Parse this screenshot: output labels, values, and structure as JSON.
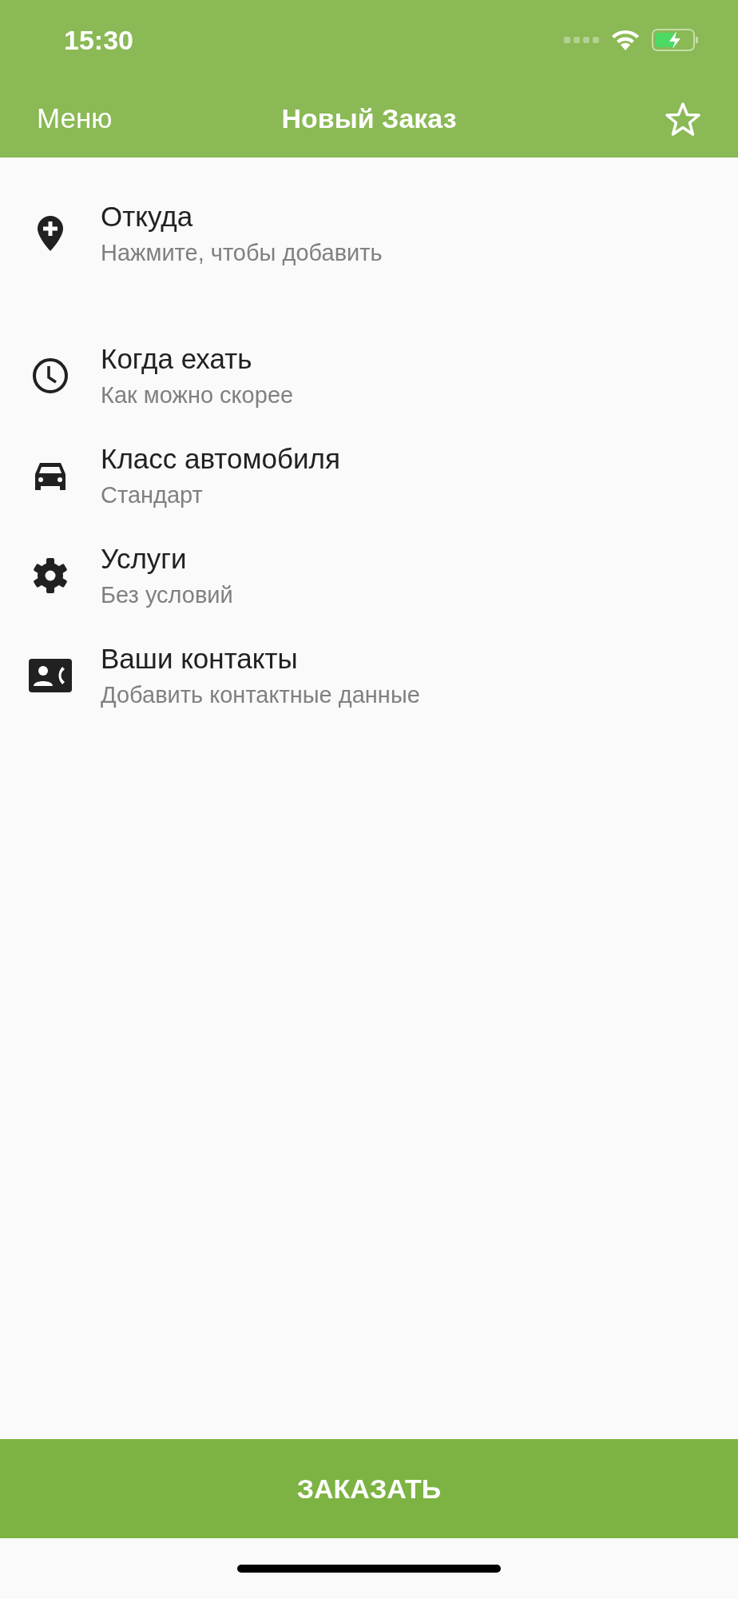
{
  "status_bar": {
    "time": "15:30"
  },
  "nav_bar": {
    "left": "Меню",
    "title": "Новый Заказ"
  },
  "items": [
    {
      "kind": "pin",
      "title": "Откуда",
      "subtitle": "Нажмите, чтобы добавить"
    },
    {
      "kind": "clock",
      "title": "Когда ехать",
      "subtitle": "Как можно скорее"
    },
    {
      "kind": "car",
      "title": "Класс автомобиля",
      "subtitle": "Стандарт"
    },
    {
      "kind": "gear",
      "title": "Услуги",
      "subtitle": "Без условий"
    },
    {
      "kind": "contact",
      "title": "Ваши контакты",
      "subtitle": "Добавить контактные данные"
    }
  ],
  "order_button": "ЗАКАЗАТЬ"
}
